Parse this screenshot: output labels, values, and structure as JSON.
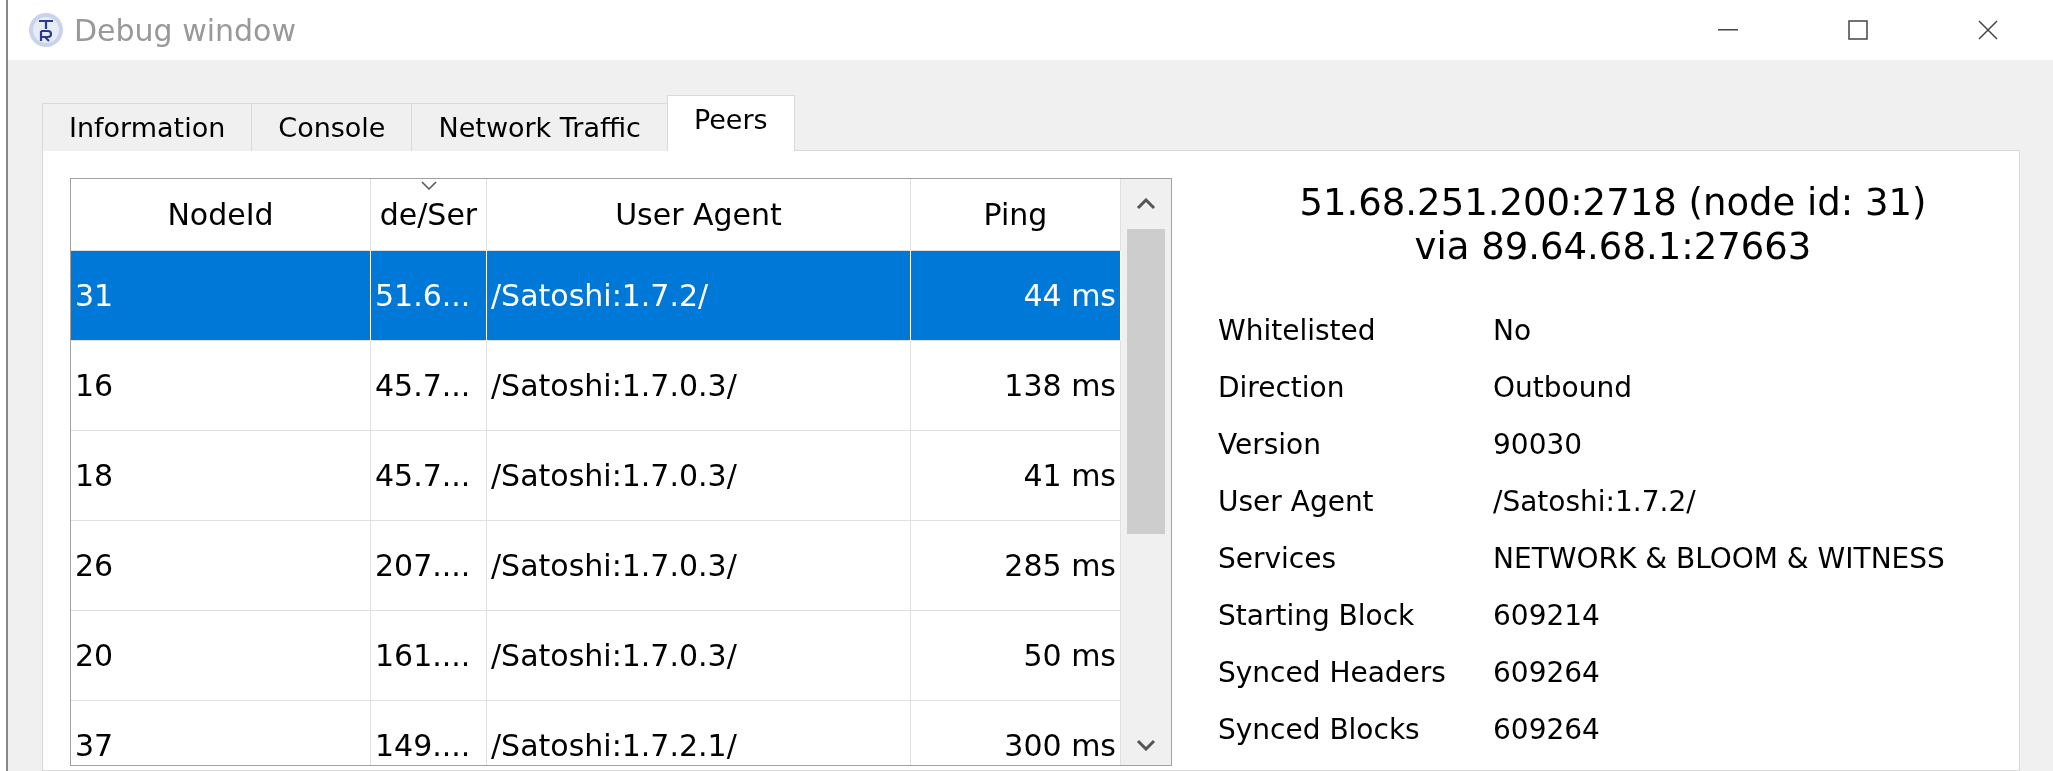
{
  "window": {
    "title": "Debug window"
  },
  "tabs": [
    {
      "label": "Information",
      "selected": false
    },
    {
      "label": "Console",
      "selected": false
    },
    {
      "label": "Network Traffic",
      "selected": false
    },
    {
      "label": "Peers",
      "selected": true
    }
  ],
  "peers_table": {
    "columns": [
      {
        "label": "NodeId",
        "sorted": false
      },
      {
        "label": "de/Ser",
        "sorted": true
      },
      {
        "label": "User Agent",
        "sorted": false
      },
      {
        "label": "Ping",
        "sorted": false
      }
    ],
    "rows": [
      {
        "node_id": "31",
        "address": "51.6...",
        "user_agent": "/Satoshi:1.7.2/",
        "ping": "44 ms",
        "selected": true
      },
      {
        "node_id": "16",
        "address": "45.7...",
        "user_agent": "/Satoshi:1.7.0.3/",
        "ping": "138 ms",
        "selected": false
      },
      {
        "node_id": "18",
        "address": "45.7...",
        "user_agent": "/Satoshi:1.7.0.3/",
        "ping": "41 ms",
        "selected": false
      },
      {
        "node_id": "26",
        "address": "207....",
        "user_agent": "/Satoshi:1.7.0.3/",
        "ping": "285 ms",
        "selected": false
      },
      {
        "node_id": "20",
        "address": "161....",
        "user_agent": "/Satoshi:1.7.0.3/",
        "ping": "50 ms",
        "selected": false
      },
      {
        "node_id": "37",
        "address": "149....",
        "user_agent": "/Satoshi:1.7.2.1/",
        "ping": "300 ms",
        "selected": false
      }
    ]
  },
  "peer_details": {
    "title": "51.68.251.200:2718 (node id: 31)",
    "subtitle": "via 89.64.68.1:27663",
    "fields": [
      {
        "label": "Whitelisted",
        "value": "No"
      },
      {
        "label": "Direction",
        "value": "Outbound"
      },
      {
        "label": "Version",
        "value": "90030"
      },
      {
        "label": "User Agent",
        "value": "/Satoshi:1.7.2/"
      },
      {
        "label": "Services",
        "value": "NETWORK & BLOOM & WITNESS"
      },
      {
        "label": "Starting Block",
        "value": "609214"
      },
      {
        "label": "Synced Headers",
        "value": "609264"
      },
      {
        "label": "Synced Blocks",
        "value": "609264"
      }
    ]
  }
}
